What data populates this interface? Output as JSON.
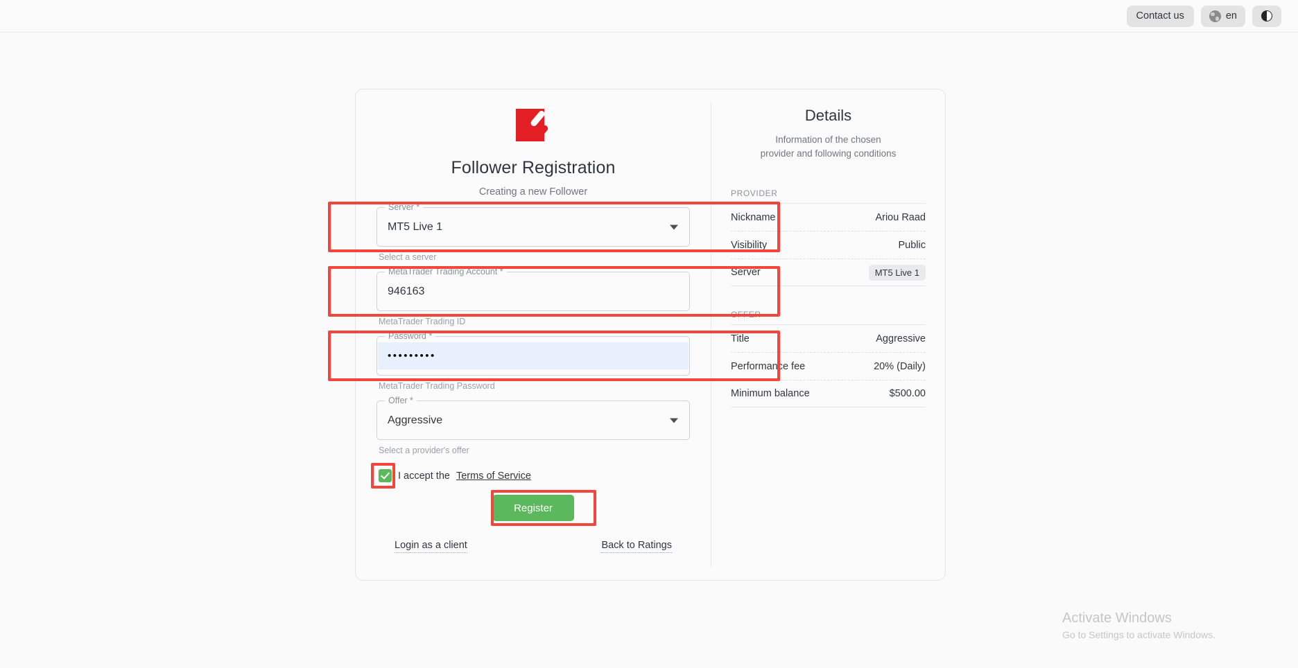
{
  "topbar": {
    "contact_label": "Contact us",
    "language_code": "en",
    "globe_icon": "globe-icon",
    "theme_icon": "half-circle-contrast-icon"
  },
  "form": {
    "logo_icon": "brand-logo-icon",
    "title": "Follower Registration",
    "subtitle": "Creating a new Follower",
    "fields": [
      {
        "label": "Server *",
        "value": "MT5 Live 1",
        "helper": "Select a server",
        "type": "select"
      },
      {
        "label": "MetaTrader Trading Account *",
        "value": "946163",
        "helper": "MetaTrader Trading ID",
        "type": "text"
      },
      {
        "label": "Password *",
        "value": "•••••••••",
        "helper": "MetaTrader Trading Password",
        "type": "password"
      },
      {
        "label": "Offer *",
        "value": "Aggressive",
        "helper": "Select a provider's offer",
        "type": "select"
      }
    ],
    "terms_prefix": "I accept the",
    "terms_link": "Terms of Service",
    "terms_checked": true,
    "register_label": "Register",
    "login_link": "Login as a client",
    "back_link": "Back to Ratings"
  },
  "details": {
    "title": "Details",
    "subtitle_line1": "Information of the chosen",
    "subtitle_line2": "provider and following conditions",
    "provider_label": "PROVIDER",
    "provider_rows": [
      {
        "key": "Nickname",
        "value": "Ariou Raad"
      },
      {
        "key": "Visibility",
        "value": "Public"
      },
      {
        "key": "Server",
        "value": "MT5 Live 1"
      }
    ],
    "offer_label": "OFFER",
    "offer_rows": [
      {
        "key": "Title",
        "value": "Aggressive"
      },
      {
        "key": "Performance fee",
        "value": "20% (Daily)"
      },
      {
        "key": "Minimum balance",
        "value": "$500.00"
      }
    ]
  },
  "watermark": {
    "title": "Activate Windows",
    "subtitle": "Go to Settings to activate Windows."
  },
  "colors": {
    "brand_red": "#e31e24",
    "accent_green": "#5cb85c",
    "annotation_red": "#f4453c",
    "autofill_blue": "#e8f0fe"
  }
}
